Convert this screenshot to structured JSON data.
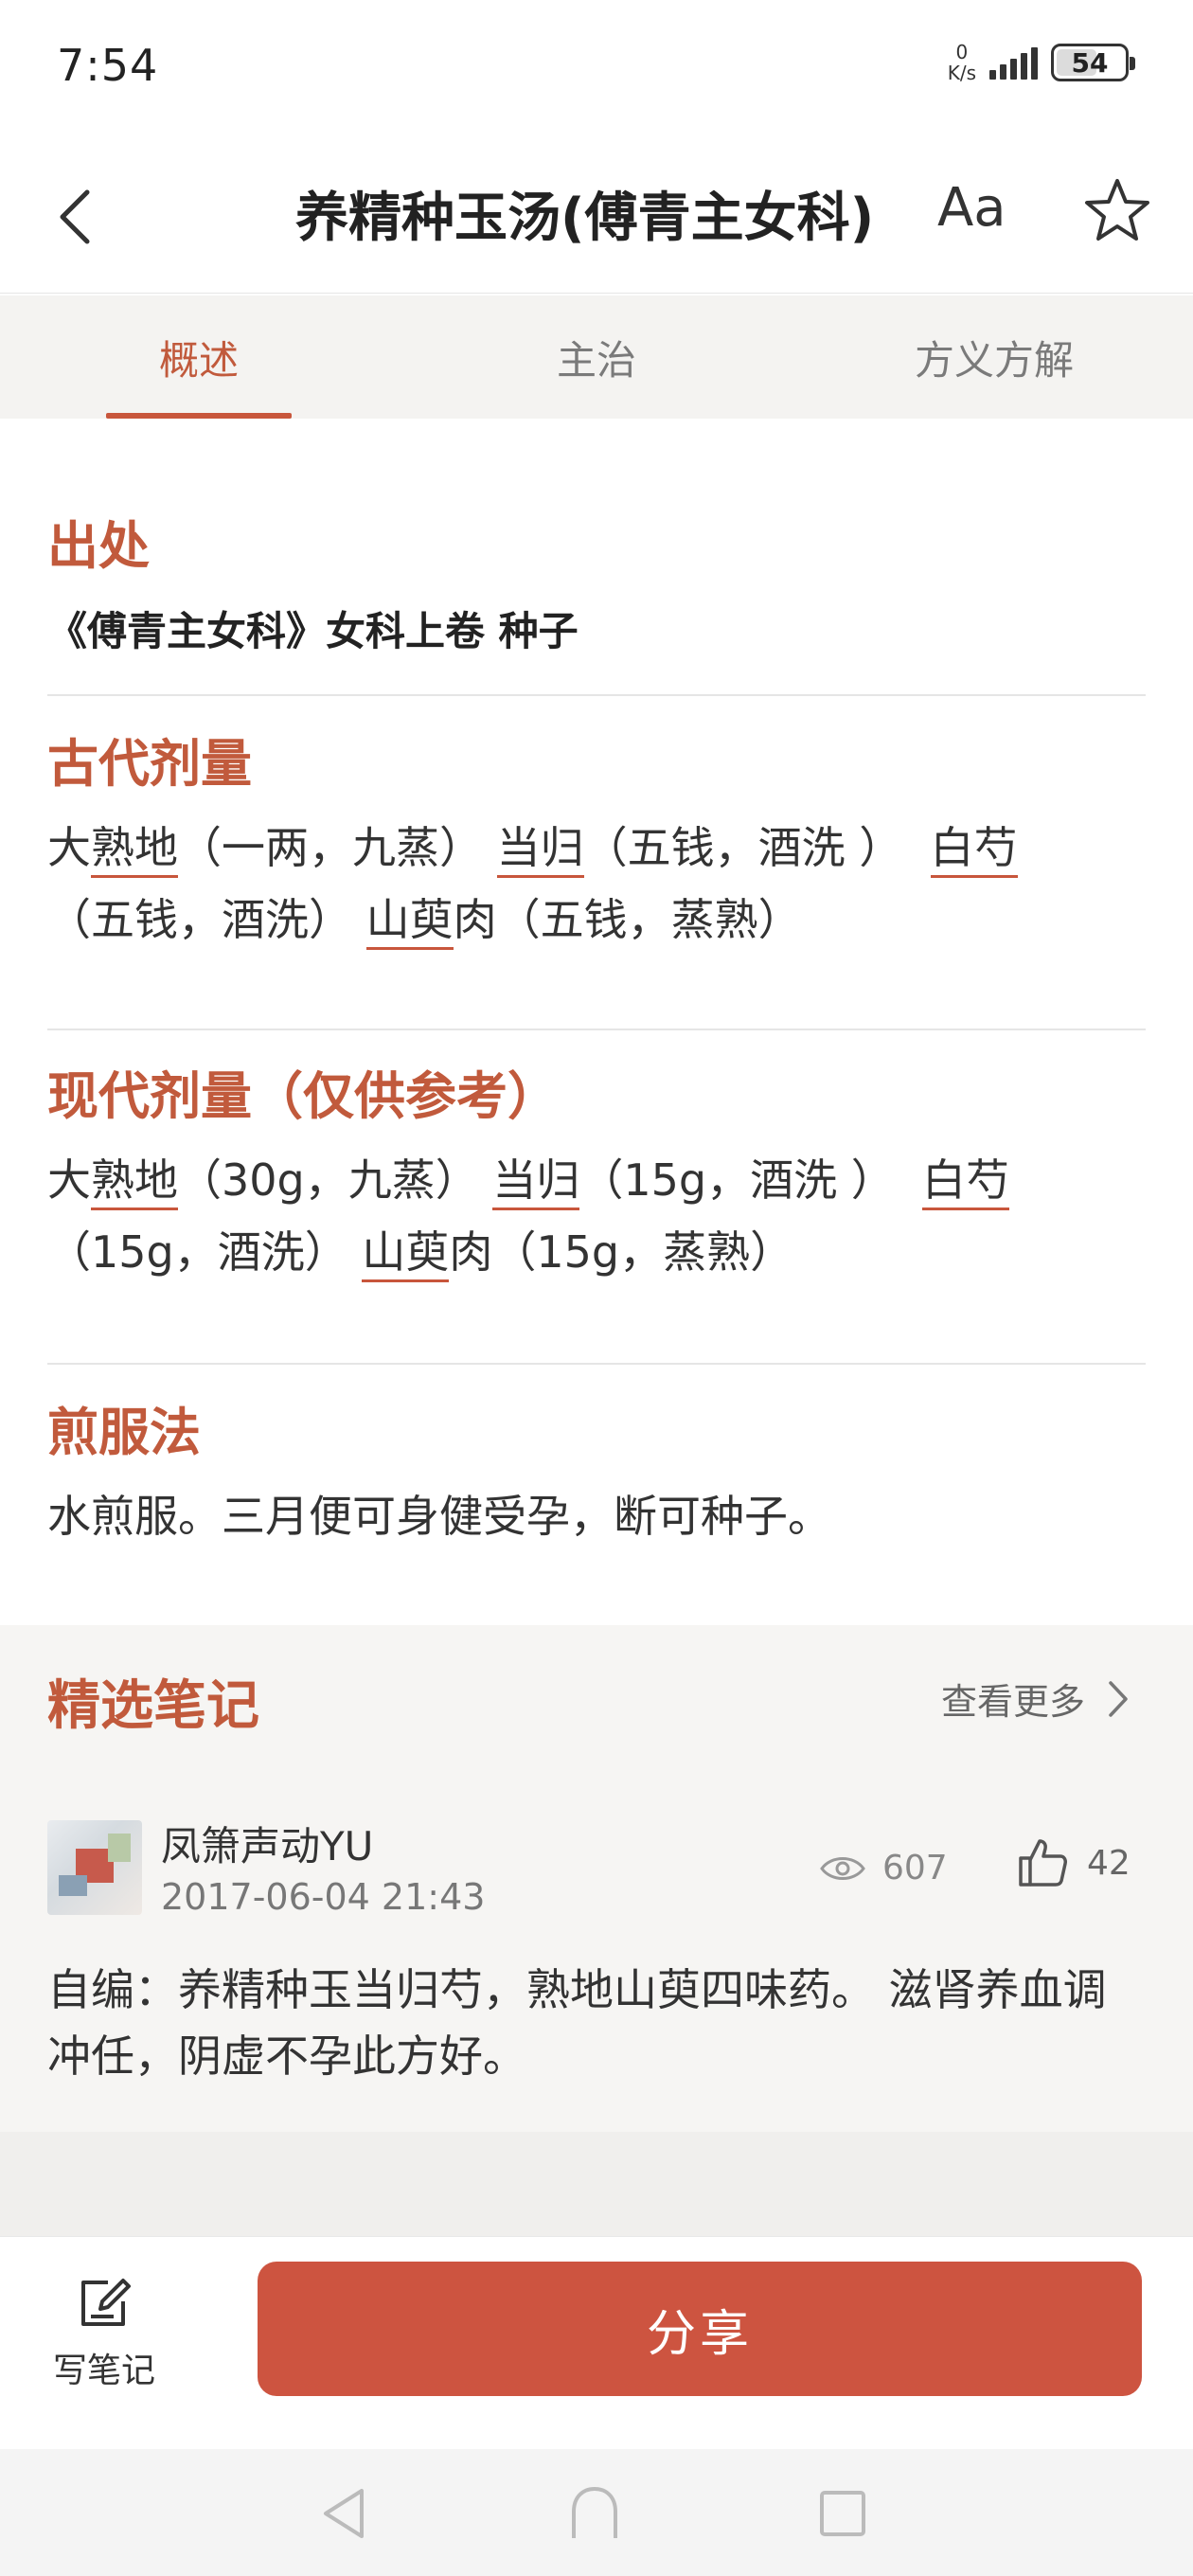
{
  "status_bar": {
    "time": "7:54",
    "net_speed_value": "0",
    "net_speed_unit": "K/s",
    "battery": "54"
  },
  "header": {
    "title": "养精种玉汤(傅青主女科)",
    "font_button": "Aa"
  },
  "tabs": [
    {
      "label": "概述",
      "active": true
    },
    {
      "label": "主治",
      "active": false
    },
    {
      "label": "方义方解",
      "active": false
    }
  ],
  "source": {
    "title": "出处",
    "text": "《傅青主女科》女科上卷 种子"
  },
  "ancient_dosage": {
    "title": "古代剂量",
    "items": [
      {
        "prefix": "大",
        "herb": "熟地",
        "suffix": "（一两，九蒸）"
      },
      {
        "prefix": "",
        "herb": "当归",
        "suffix": "（五钱，酒洗 ）"
      },
      {
        "prefix": "",
        "herb": "白芍",
        "suffix": "（五钱，酒洗）"
      },
      {
        "prefix": "",
        "herb": "山萸",
        "suffix": "肉（五钱，蒸熟）"
      }
    ]
  },
  "modern_dosage": {
    "title": "现代剂量（仅供参考）",
    "items": [
      {
        "prefix": "大",
        "herb": "熟地",
        "suffix": "（30g，九蒸）"
      },
      {
        "prefix": "",
        "herb": "当归",
        "suffix": "（15g，酒洗 ）"
      },
      {
        "prefix": "",
        "herb": "白芍",
        "suffix": "（15g，酒洗）"
      },
      {
        "prefix": "",
        "herb": "山萸",
        "suffix": "肉（15g，蒸熟）"
      }
    ]
  },
  "decoction": {
    "title": "煎服法",
    "text": "水煎服。三月便可身健受孕，断可种子。"
  },
  "notes": {
    "title": "精选笔记",
    "more_label": "查看更多",
    "items": [
      {
        "author": "凤箫声动YU",
        "date": "2017-06-04 21:43",
        "views": "607",
        "likes": "42",
        "text": "自编：养精种玉当归芍，熟地山萸四味药。 滋肾养血调冲任，阴虚不孕此方好。"
      }
    ]
  },
  "bottom_bar": {
    "write_note_label": "写笔记",
    "share_label": "分享"
  },
  "colors": {
    "accent": "#c15a3c",
    "share_button": "#cd5440",
    "herb_underline": "#c8563c"
  },
  "icons": [
    "back-icon",
    "star-icon",
    "chevron-right-icon",
    "eye-icon",
    "thumbs-up-icon",
    "edit-note-icon",
    "nav-back-icon",
    "nav-home-icon",
    "nav-recents-icon"
  ]
}
